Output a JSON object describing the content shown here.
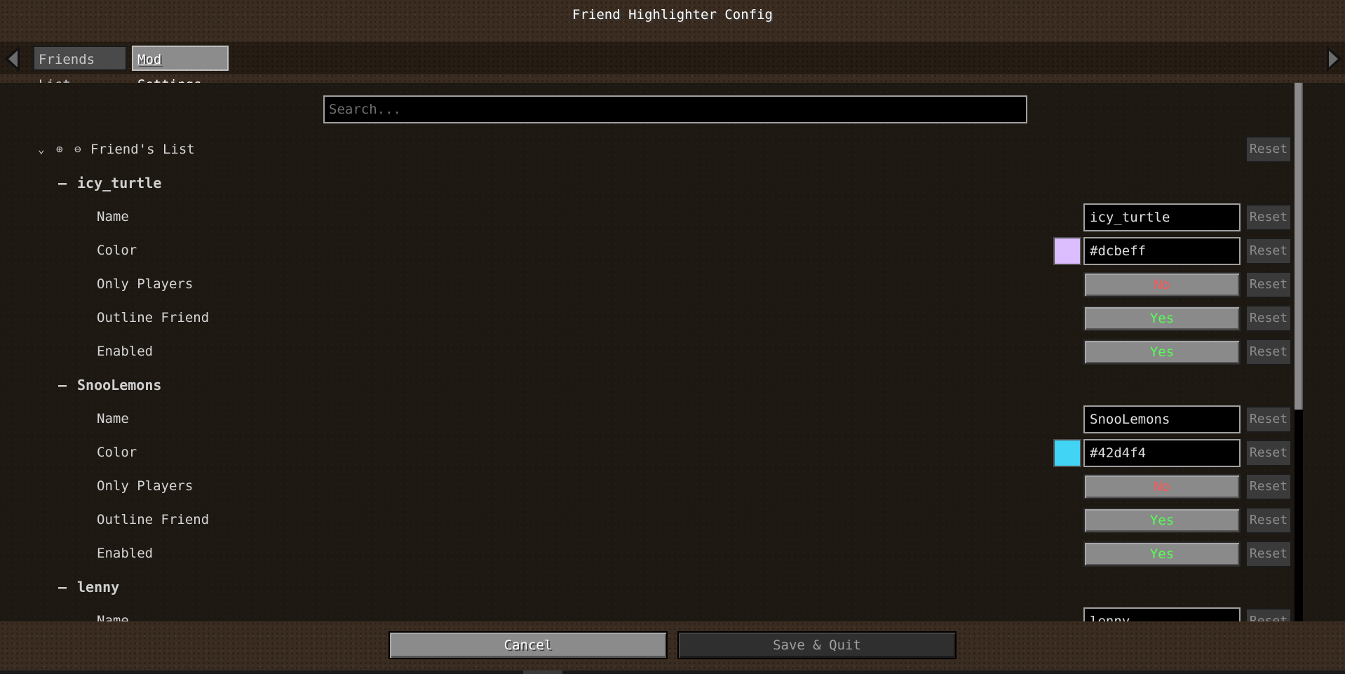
{
  "window": {
    "title": "Friend Highlighter Config"
  },
  "tabs": [
    {
      "label": "Friends List"
    },
    {
      "label": "Mod Settings"
    }
  ],
  "search": {
    "placeholder": "Search..."
  },
  "category": {
    "label": "Friend's List",
    "reset_label": "Reset"
  },
  "friends": [
    {
      "name": "icy_turtle",
      "fields": {
        "name_label": "Name",
        "name_value": "icy_turtle",
        "color_label": "Color",
        "color_value": "#dcbeff",
        "swatch": "#dcbeff",
        "only_players_label": "Only Players",
        "only_players_value": "No",
        "outline_label": "Outline Friend",
        "outline_value": "Yes",
        "enabled_label": "Enabled",
        "enabled_value": "Yes"
      }
    },
    {
      "name": "SnooLemons",
      "fields": {
        "name_label": "Name",
        "name_value": "SnooLemons",
        "color_label": "Color",
        "color_value": "#42d4f4",
        "swatch": "#42d4f4",
        "only_players_label": "Only Players",
        "only_players_value": "No",
        "outline_label": "Outline Friend",
        "outline_value": "Yes",
        "enabled_label": "Enabled",
        "enabled_value": "Yes"
      }
    },
    {
      "name": "lenny",
      "fields": {
        "name_label": "Name",
        "name_value": "lenny"
      }
    }
  ],
  "reset_label": "Reset",
  "footer": {
    "cancel_label": "Cancel",
    "save_label": "Save & Quit"
  },
  "colors": {
    "yes": "#55ff55",
    "no": "#ff5555"
  }
}
